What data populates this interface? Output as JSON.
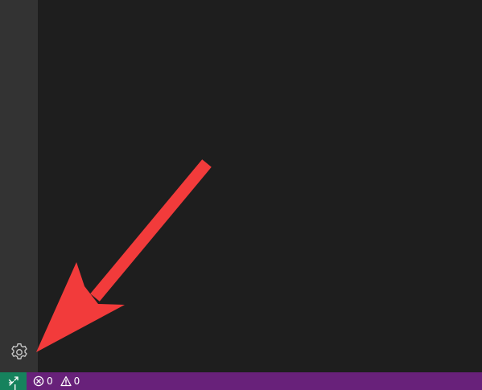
{
  "status_bar": {
    "error_count": "0",
    "warning_count": "0"
  },
  "icons": {
    "manage": "gear-icon",
    "remote": "remote-icon",
    "error": "error-icon",
    "warning": "warning-icon"
  },
  "colors": {
    "activity_bar": "#333333",
    "editor_background": "#1e1e1e",
    "status_bar": "#68217a",
    "remote_indicator": "#16825d",
    "annotation_arrow": "#f23b3b",
    "gear_icon": "#c5c5c5"
  }
}
